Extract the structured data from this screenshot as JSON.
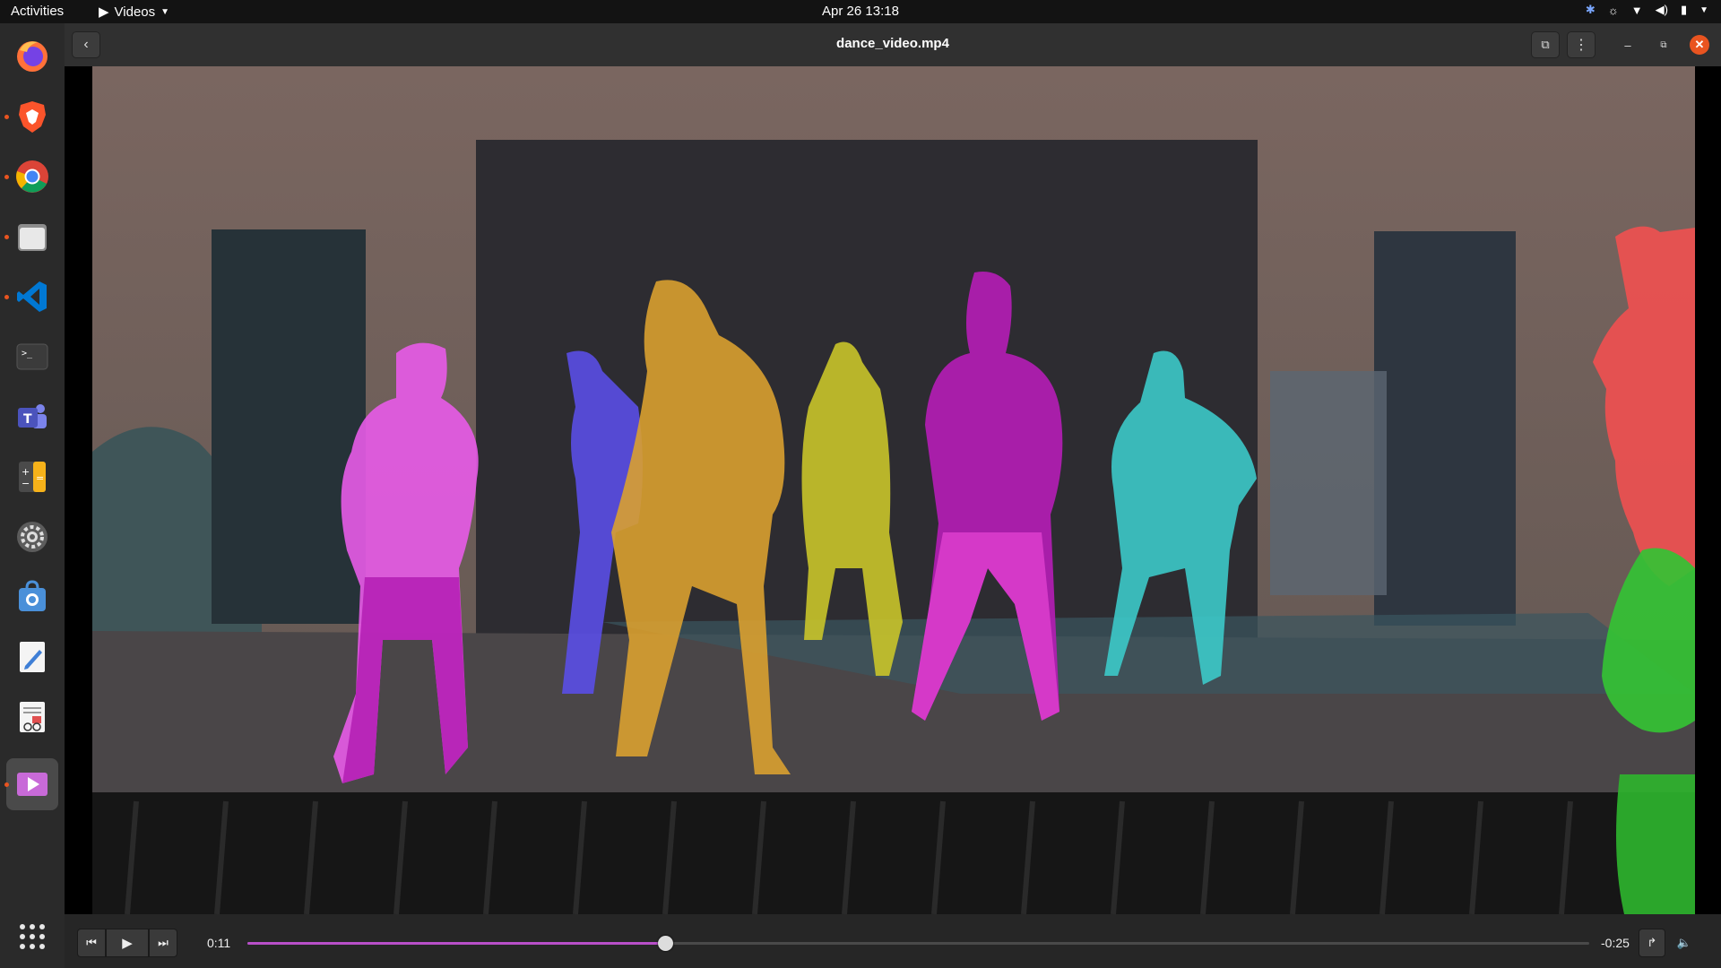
{
  "topbar": {
    "activities": "Activities",
    "app_menu": "Videos",
    "clock": "Apr 26  13:18"
  },
  "dock": {
    "items": [
      {
        "name": "firefox-icon",
        "running": false
      },
      {
        "name": "brave-icon",
        "running": true
      },
      {
        "name": "chrome-icon",
        "running": true
      },
      {
        "name": "files-icon",
        "running": true
      },
      {
        "name": "vscode-icon",
        "running": true
      },
      {
        "name": "terminal-icon",
        "running": false
      },
      {
        "name": "teams-icon",
        "running": false
      },
      {
        "name": "calculator-icon",
        "running": false
      },
      {
        "name": "settings-icon",
        "running": false
      },
      {
        "name": "software-center-icon",
        "running": false
      },
      {
        "name": "text-editor-icon",
        "running": false
      },
      {
        "name": "document-viewer-icon",
        "running": false
      },
      {
        "name": "videos-icon",
        "running": true,
        "active": true
      }
    ],
    "show_apps": "show-applications-icon"
  },
  "window": {
    "title": "dance_video.mp4"
  },
  "player": {
    "current_time": "0:11",
    "remaining_time": "-0:25",
    "progress": 0.311
  },
  "colors": {
    "accent": "#e95420",
    "seek_fill": "#b84fc9",
    "mask_pink": "#e85be8",
    "mask_blue": "#5a4ee6",
    "mask_orange": "#d9a030",
    "mask_yellow": "#c9c42a",
    "mask_purple": "#b31db3",
    "mask_cyan": "#3cc9c9",
    "mask_red": "#ee5050",
    "mask_green": "#34c234"
  }
}
